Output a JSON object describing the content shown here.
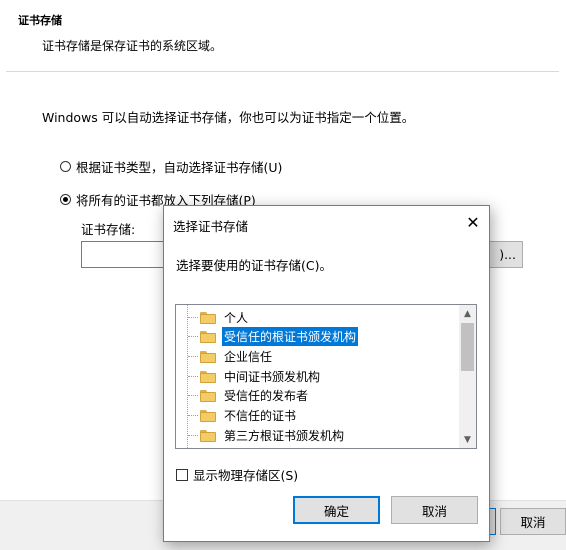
{
  "wizard": {
    "heading": "证书存储",
    "subheading": "证书存储是保存证书的系统区域。",
    "description": "Windows 可以自动选择证书存储，你也可以为证书指定一个位置。",
    "radio_auto": "根据证书类型，自动选择证书存储(U)",
    "radio_manual": "将所有的证书都放入下列存储(P)",
    "store_label": "证书存储:",
    "store_value": "",
    "browse_label": ")...",
    "cancel_label": "取消"
  },
  "dialog": {
    "title": "选择证书存储",
    "close_glyph": "✕",
    "prompt": "选择要使用的证书存储(C)。",
    "stores": [
      {
        "label": "个人",
        "selected": false
      },
      {
        "label": "受信任的根证书颁发机构",
        "selected": true
      },
      {
        "label": "企业信任",
        "selected": false
      },
      {
        "label": "中间证书颁发机构",
        "selected": false
      },
      {
        "label": "受信任的发布者",
        "selected": false
      },
      {
        "label": "不信任的证书",
        "selected": false
      },
      {
        "label": "第三方根证书颁发机构",
        "selected": false
      }
    ],
    "show_physical": "显示物理存储区(S)",
    "ok_label": "确定",
    "cancel_label": "取消"
  },
  "icons": {
    "folder": "folder-icon",
    "scroll_up": "▲",
    "scroll_down": "▼"
  },
  "colors": {
    "accent": "#0078d7",
    "folder": "#f4cc66"
  }
}
